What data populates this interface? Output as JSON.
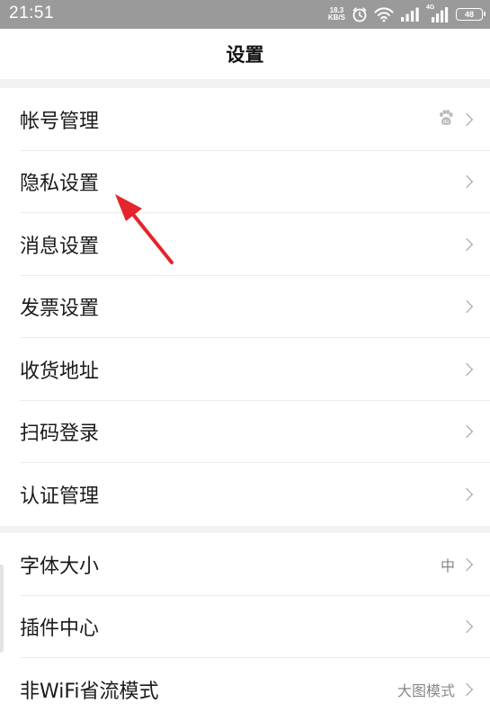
{
  "status_bar": {
    "time": "21:51",
    "net_speed_value": "18.3",
    "net_speed_unit": "KB/S",
    "network_label": "4G",
    "battery": "48"
  },
  "header": {
    "title": "设置"
  },
  "group1": [
    {
      "label": "帐号管理",
      "value": "",
      "icon": "baidu-paw-icon"
    },
    {
      "label": "隐私设置",
      "value": ""
    },
    {
      "label": "消息设置",
      "value": ""
    },
    {
      "label": "发票设置",
      "value": ""
    },
    {
      "label": "收货地址",
      "value": ""
    },
    {
      "label": "扫码登录",
      "value": ""
    },
    {
      "label": "认证管理",
      "value": ""
    }
  ],
  "group2": [
    {
      "label": "字体大小",
      "value": "中"
    },
    {
      "label": "插件中心",
      "value": ""
    },
    {
      "label": "非WiFi省流模式",
      "value": "大图模式"
    }
  ],
  "colors": {
    "status_bar_bg": "#9a9a9a",
    "page_bg": "#f2f2f4",
    "arrow": "#e3262b"
  }
}
